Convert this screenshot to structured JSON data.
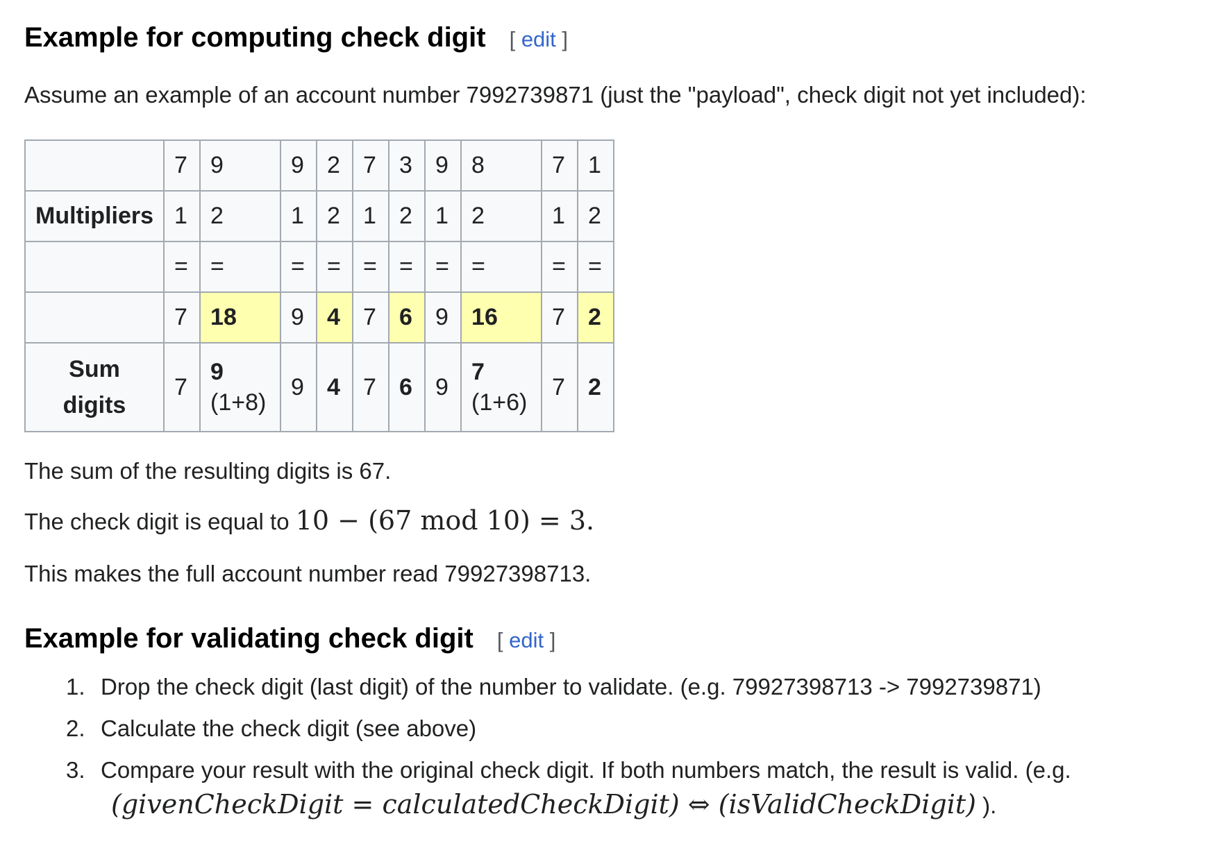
{
  "section1": {
    "heading": "Example for computing check digit",
    "edit_open": "[",
    "edit_label": "edit",
    "edit_close": "]",
    "intro": "Assume an example of an account number 7992739871 (just the \"payload\", check digit not yet included):"
  },
  "table": {
    "digits": [
      "7",
      "9",
      "9",
      "2",
      "7",
      "3",
      "9",
      "8",
      "7",
      "1"
    ],
    "multipliers_label": "Multipliers",
    "multipliers": [
      "1",
      "2",
      "1",
      "2",
      "1",
      "2",
      "1",
      "2",
      "1",
      "2"
    ],
    "equals": [
      "=",
      "=",
      "=",
      "=",
      "=",
      "=",
      "=",
      "=",
      "=",
      "="
    ],
    "products": [
      "7",
      "18",
      "9",
      "4",
      "7",
      "6",
      "9",
      "16",
      "7",
      "2"
    ],
    "sum_label_line1": "Sum",
    "sum_label_line2": "digits",
    "sum_digits": [
      "7",
      "9",
      "9",
      "4",
      "7",
      "6",
      "9",
      "7",
      "7",
      "2"
    ],
    "sum_notes": [
      "",
      "(1+8)",
      "",
      "",
      "",
      "",
      "",
      "(1+6)",
      "",
      ""
    ]
  },
  "result": {
    "sum_text": "The sum of the resulting digits is 67.",
    "check_prefix": "The check digit is equal to ",
    "check_formula": "10 − (67 mod 10) = 3.",
    "full_text": "This makes the full account number read 79927398713."
  },
  "section2": {
    "heading": "Example for validating check digit",
    "edit_open": "[",
    "edit_label": "edit",
    "edit_close": "]",
    "steps": [
      {
        "num": "1.",
        "text": "Drop the check digit (last digit) of the number to validate. (e.g. 79927398713 -> 7992739871)"
      },
      {
        "num": "2.",
        "text": "Calculate the check digit (see above)"
      },
      {
        "num": "3.",
        "text": "Compare your result with the original check digit. If both numbers match, the result is valid. (e.g.",
        "formula": "(givenCheckDigit = calculatedCheckDigit) ⇔ (isValidCheckDigit)",
        "formula_tail": " )."
      }
    ]
  }
}
